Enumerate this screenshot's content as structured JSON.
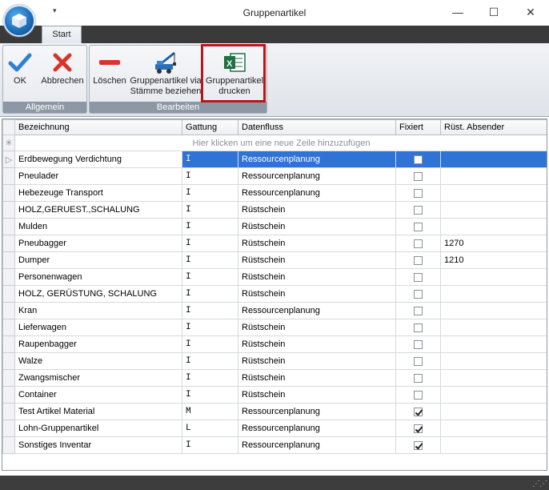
{
  "window": {
    "title": "Gruppenartikel",
    "minimize_label": "—",
    "maximize_label": "☐",
    "close_label": "✕",
    "qa_arrow": "▾"
  },
  "ribbon": {
    "tab": "Start",
    "groups": [
      {
        "label": "Allgemein",
        "buttons": [
          {
            "label": "OK",
            "icon": "check-icon"
          },
          {
            "label": "Abbrechen",
            "icon": "x-icon"
          }
        ]
      },
      {
        "label": "Bearbeiten",
        "buttons": [
          {
            "label": "Löschen",
            "icon": "minus-icon"
          },
          {
            "label": "Gruppenartikel via Stämme beziehen",
            "line1": "Gruppenartikel via",
            "line2": "Stämme beziehen",
            "icon": "crane-icon"
          },
          {
            "label": "Gruppenartikel drucken",
            "line1": "Gruppenartikel",
            "line2": "drucken",
            "icon": "excel-icon"
          }
        ]
      }
    ],
    "colors": {
      "accent": "#2f73d6",
      "highlight_border": "#b9151b"
    }
  },
  "grid": {
    "columns": [
      "Bezeichnung",
      "Gattung",
      "Datenfluss",
      "Fixiert",
      "Rüst. Absender"
    ],
    "new_row_hint": "Hier klicken um eine neue Zeile hinzuzufügen",
    "new_row_marker": "✳",
    "current_row_marker": "▷",
    "rows": [
      {
        "bezeichnung": "Erdbewegung Verdichtung",
        "gattung": "I",
        "datenfluss": "Ressourcenplanung",
        "fixiert": false,
        "absender": "",
        "selected": true
      },
      {
        "bezeichnung": "Pneulader",
        "gattung": "I",
        "datenfluss": "Ressourcenplanung",
        "fixiert": false,
        "absender": ""
      },
      {
        "bezeichnung": "Hebezeuge Transport",
        "gattung": "I",
        "datenfluss": "Ressourcenplanung",
        "fixiert": false,
        "absender": ""
      },
      {
        "bezeichnung": "HOLZ,GERUEST.,SCHALUNG",
        "gattung": "I",
        "datenfluss": "Rüstschein",
        "fixiert": false,
        "absender": ""
      },
      {
        "bezeichnung": "Mulden",
        "gattung": "I",
        "datenfluss": "Rüstschein",
        "fixiert": false,
        "absender": ""
      },
      {
        "bezeichnung": "Pneubagger",
        "gattung": "I",
        "datenfluss": "Rüstschein",
        "fixiert": false,
        "absender": "1270"
      },
      {
        "bezeichnung": "Dumper",
        "gattung": "I",
        "datenfluss": "Rüstschein",
        "fixiert": false,
        "absender": "1210"
      },
      {
        "bezeichnung": "Personenwagen",
        "gattung": "I",
        "datenfluss": "Rüstschein",
        "fixiert": false,
        "absender": ""
      },
      {
        "bezeichnung": "HOLZ, GERÜSTUNG, SCHALUNG",
        "gattung": "I",
        "datenfluss": "Rüstschein",
        "fixiert": false,
        "absender": ""
      },
      {
        "bezeichnung": "Kran",
        "gattung": "I",
        "datenfluss": "Ressourcenplanung",
        "fixiert": false,
        "absender": ""
      },
      {
        "bezeichnung": "Lieferwagen",
        "gattung": "I",
        "datenfluss": "Rüstschein",
        "fixiert": false,
        "absender": ""
      },
      {
        "bezeichnung": "Raupenbagger",
        "gattung": "I",
        "datenfluss": "Rüstschein",
        "fixiert": false,
        "absender": ""
      },
      {
        "bezeichnung": "Walze",
        "gattung": "I",
        "datenfluss": "Rüstschein",
        "fixiert": false,
        "absender": ""
      },
      {
        "bezeichnung": "Zwangsmischer",
        "gattung": "I",
        "datenfluss": "Rüstschein",
        "fixiert": false,
        "absender": ""
      },
      {
        "bezeichnung": "Container",
        "gattung": "I",
        "datenfluss": "Rüstschein",
        "fixiert": false,
        "absender": ""
      },
      {
        "bezeichnung": "Test Artikel Material",
        "gattung": "M",
        "datenfluss": "Ressourcenplanung",
        "fixiert": true,
        "absender": ""
      },
      {
        "bezeichnung": "Lohn-Gruppenartikel",
        "gattung": "L",
        "datenfluss": "Ressourcenplanung",
        "fixiert": true,
        "absender": ""
      },
      {
        "bezeichnung": "Sonstiges Inventar",
        "gattung": "I",
        "datenfluss": "Ressourcenplanung",
        "fixiert": true,
        "absender": ""
      }
    ]
  }
}
